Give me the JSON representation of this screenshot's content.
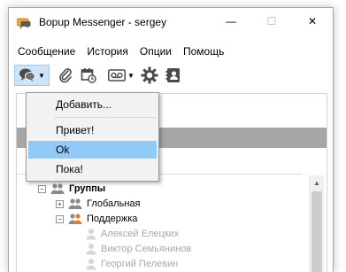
{
  "window": {
    "title": "Bopup Messenger - sergey",
    "controls": {
      "minimize": "—",
      "maximize": "☐",
      "close": "✕"
    }
  },
  "menubar": {
    "items": [
      "Сообщение",
      "История",
      "Опции",
      "Помощь"
    ]
  },
  "toolbar": {
    "buttons": [
      "message-icon",
      "attach-icon",
      "calendar-icon",
      "voicemail-icon",
      "gear-icon",
      "contacts-icon"
    ]
  },
  "popup_menu": {
    "items": [
      {
        "label": "Добавить..."
      },
      {
        "label": "Привет!"
      },
      {
        "label": "Ok",
        "selected": true
      },
      {
        "label": "Пока!"
      }
    ]
  },
  "tree": {
    "root": {
      "label": "Группы",
      "expander": "−"
    },
    "groups": [
      {
        "label": "Глобальная",
        "expander": "+"
      },
      {
        "label": "Поддержка",
        "expander": "−"
      }
    ],
    "members": [
      "Алексей Елецких",
      "Виктор Семьянинов",
      "Георгий Пелевин"
    ]
  },
  "colors": {
    "selection": "#91c9f7",
    "header_gray": "#a6a6a6",
    "accent_orange": "#e07b2c"
  }
}
